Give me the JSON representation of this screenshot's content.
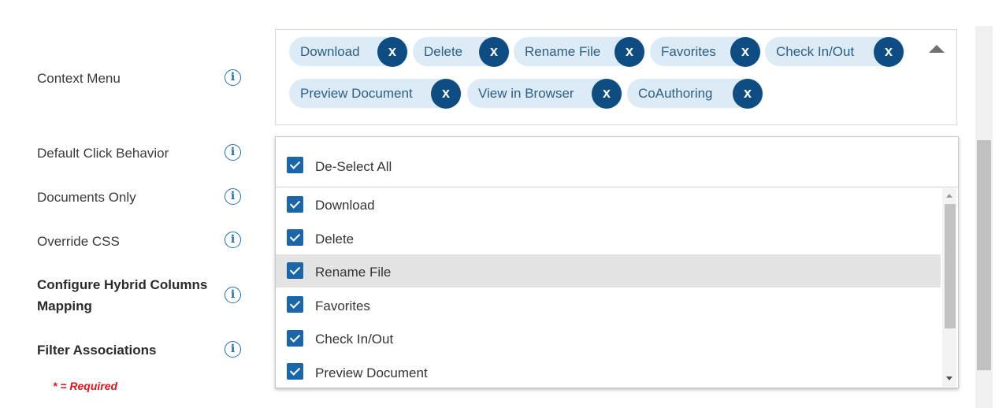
{
  "fields": [
    {
      "label": "Context Menu",
      "bold": false
    },
    {
      "label": "Default Click Behavior",
      "bold": false
    },
    {
      "label": "Documents Only",
      "bold": false
    },
    {
      "label": "Override CSS",
      "bold": false
    },
    {
      "label": "Configure Hybrid Columns Mapping",
      "line1": "Configure Hybrid Columns",
      "line2": "Mapping",
      "bold": true
    },
    {
      "label": "Filter Associations",
      "bold": true
    }
  ],
  "info_icon": "info-circle-icon",
  "required_note": "* = Required",
  "tags": [
    "Download",
    "Delete",
    "Rename File",
    "Favorites",
    "Check In/Out",
    "Preview Document",
    "View in Browser",
    "CoAuthoring"
  ],
  "tag_remove_label": "x",
  "dropdown": {
    "select_all_label": "De-Select All",
    "select_all_checked": true,
    "options": [
      {
        "label": "Download",
        "checked": true
      },
      {
        "label": "Delete",
        "checked": true
      },
      {
        "label": "Rename File",
        "checked": true,
        "highlighted": true
      },
      {
        "label": "Favorites",
        "checked": true
      },
      {
        "label": "Check In/Out",
        "checked": true
      },
      {
        "label": "Preview Document",
        "checked": true
      }
    ]
  },
  "colors": {
    "tag_bg": "#dcebf6",
    "tag_text": "#2d5f88",
    "tag_remove_bg": "#0f4c81",
    "checkbox": "#1a66a8",
    "info": "#1f6fb5",
    "required": "#e0141c",
    "highlight": "#e3e3e3"
  }
}
